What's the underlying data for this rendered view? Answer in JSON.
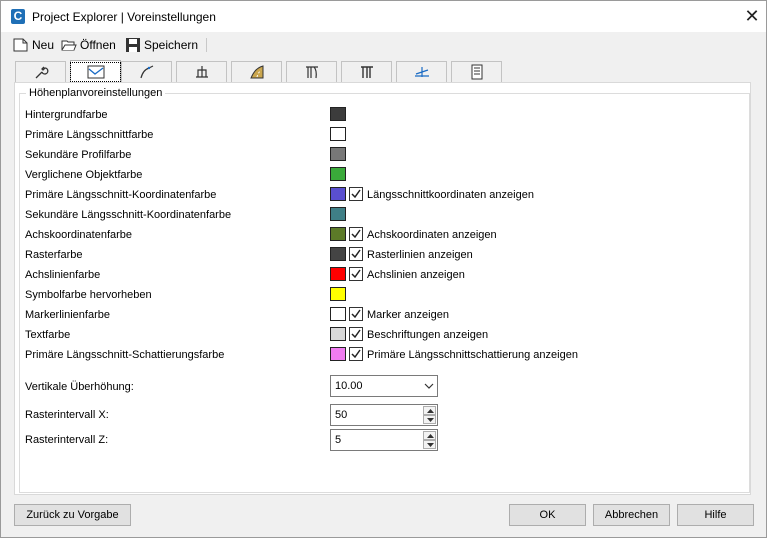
{
  "window": {
    "title": "Project Explorer | Voreinstellungen",
    "close_glyph": "✕"
  },
  "toolbar": {
    "new_label": "Neu",
    "open_label": "Öffnen",
    "save_label": "Speichern"
  },
  "tabs": [
    "wrench-icon",
    "profile-view-icon",
    "alignment-curve-icon",
    "cross-section-icon",
    "road-icon",
    "bridge-pier-icon",
    "bridge-pier-alt-icon",
    "superelevation-icon",
    "list-icon"
  ],
  "group": {
    "title": "Höhenplanvoreinstellungen"
  },
  "settings": [
    {
      "label": "Hintergrundfarbe",
      "color": "#3c3c3c"
    },
    {
      "label": "Primäre Längsschnittfarbe",
      "color": "#ffffff"
    },
    {
      "label": "Sekundäre Profilfarbe",
      "color": "#787878"
    },
    {
      "label": "Verglichene Objektfarbe",
      "color": "#3aaa3a"
    },
    {
      "label": "Primäre Längsschnitt-Koordinatenfarbe",
      "color": "#5a4fd0",
      "check_label": "Längsschnittkoordinaten anzeigen",
      "checked": true
    },
    {
      "label": "Sekundäre Längsschnitt-Koordinatenfarbe",
      "color": "#3f7f86"
    },
    {
      "label": "Achskoordinatenfarbe",
      "color": "#5c7a28",
      "check_label": "Achskoordinaten anzeigen",
      "checked": true
    },
    {
      "label": "Rasterfarbe",
      "color": "#444444",
      "check_label": "Rasterlinien anzeigen",
      "checked": true
    },
    {
      "label": "Achslinienfarbe",
      "color": "#ff0000",
      "check_label": "Achslinien anzeigen",
      "checked": true
    },
    {
      "label": "Symbolfarbe hervorheben",
      "color": "#ffff00"
    },
    {
      "label": "Markerlinienfarbe",
      "color": "#ffffff",
      "check_label": "Marker anzeigen",
      "checked": true
    },
    {
      "label": "Textfarbe",
      "color": "#d8d8d8",
      "check_label": "Beschriftungen anzeigen",
      "checked": true
    },
    {
      "label": "Primäre Längsschnitt-Schattierungsfarbe",
      "color": "#f17cf1",
      "check_label": "Primäre Längsschnittschattierung anzeigen",
      "checked": true
    }
  ],
  "fields": {
    "vertical_exaggeration": {
      "label": "Vertikale Überhöhung:",
      "value": "10.00"
    },
    "grid_x": {
      "label": "Rasterintervall X:",
      "value": "50"
    },
    "grid_z": {
      "label": "Rasterintervall Z:",
      "value": "5"
    }
  },
  "buttons": {
    "reset": "Zurück zu Vorgabe",
    "ok": "OK",
    "cancel": "Abbrechen",
    "help": "Hilfe"
  }
}
